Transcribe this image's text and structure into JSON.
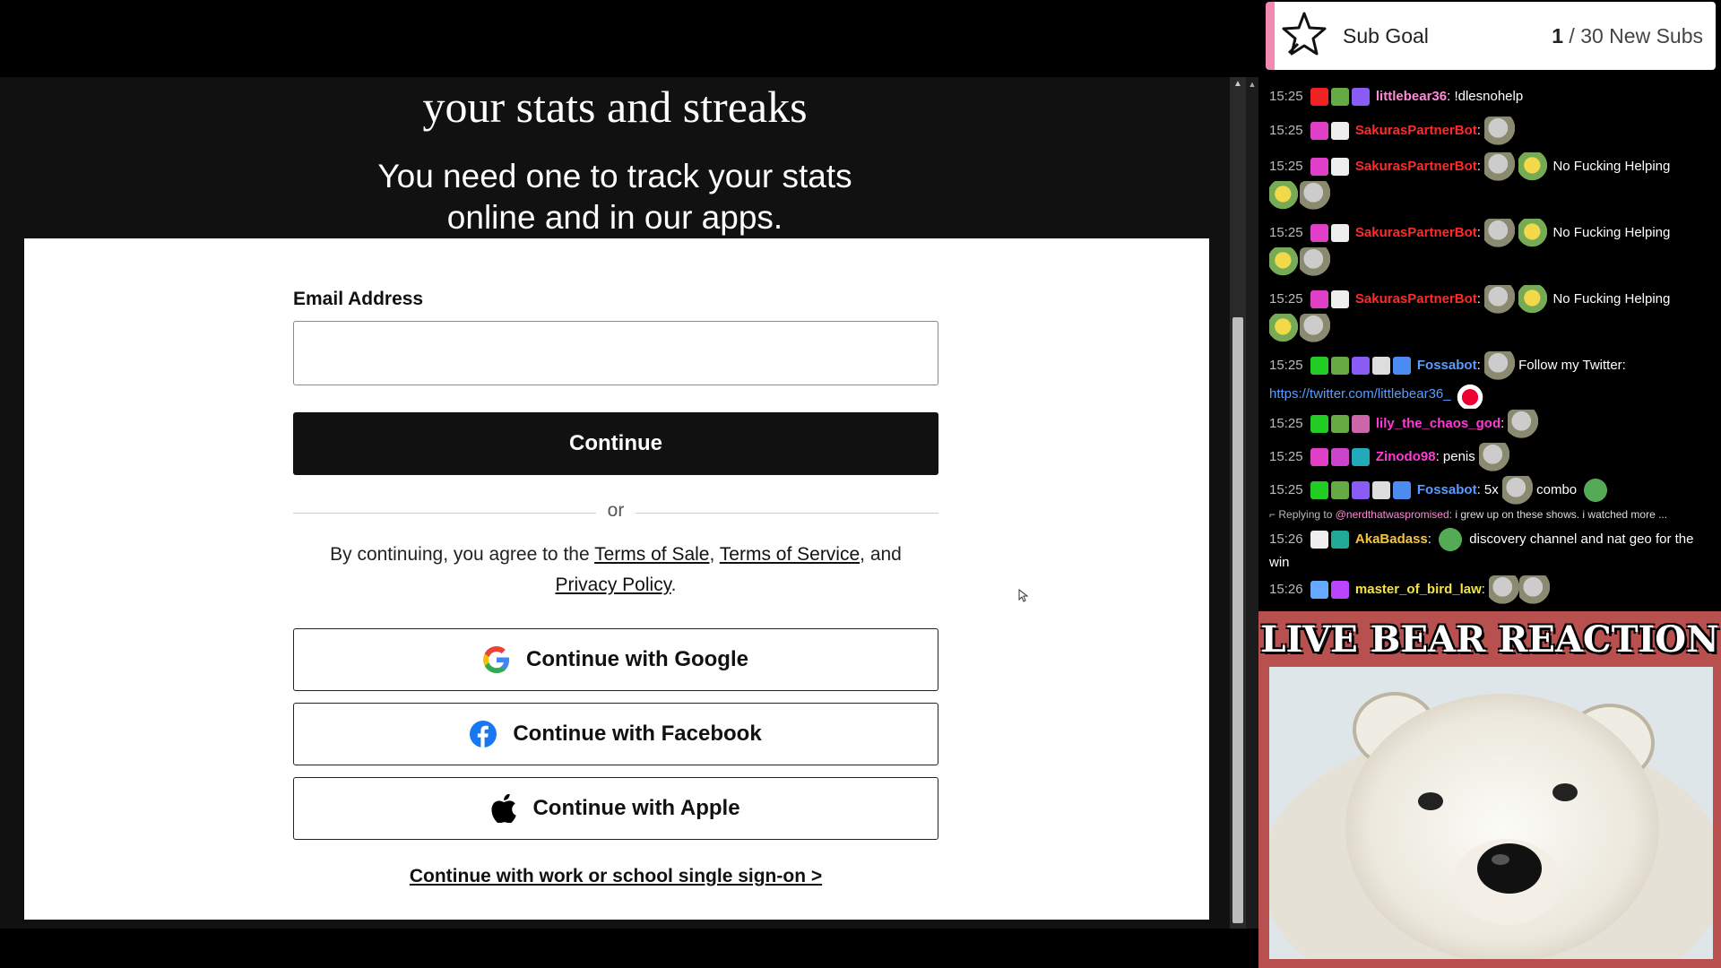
{
  "login_page": {
    "heading": "your stats and streaks",
    "subheading_line1": "You need one to track your stats",
    "subheading_line2": "online and in our apps.",
    "email_label": "Email Address",
    "email_value": "",
    "email_placeholder": "",
    "continue_label": "Continue",
    "divider_text": "or",
    "legal_prefix": "By continuing, you agree to the ",
    "terms_of_sale": "Terms of Sale",
    "comma": ", ",
    "terms_of_service": "Terms of Service",
    "and_text": ", and",
    "privacy_policy": "Privacy Policy",
    "period": ".",
    "google_label": "Continue with Google",
    "facebook_label": "Continue with Facebook",
    "apple_label": "Continue with Apple",
    "sso_label": "Continue with work or school single sign-on >"
  },
  "sub_goal": {
    "title": "Sub Goal",
    "current": "1",
    "target_text": " / 30 New Subs"
  },
  "chat": {
    "messages": [
      {
        "time": "15:25",
        "user": "littlebear36",
        "user_color": "#ff8ad8",
        "text": " !dlesnohelp"
      },
      {
        "time": "15:25",
        "user": "SakurasPartnerBot",
        "user_color": "#ff2a2a",
        "text": ""
      },
      {
        "time": "15:25",
        "user": "SakurasPartnerBot",
        "user_color": "#ff2a2a",
        "text": "No Fucking Helping"
      },
      {
        "time": "15:25",
        "user": "SakurasPartnerBot",
        "user_color": "#ff2a2a",
        "text": "No Fucking Helping"
      },
      {
        "time": "15:25",
        "user": "SakurasPartnerBot",
        "user_color": "#ff2a2a",
        "text": "No Fucking Helping"
      },
      {
        "time": "15:25",
        "user": "Fossabot",
        "user_color": "#5a9cff",
        "text": "Follow my Twitter:",
        "link": "https://twitter.com/littlebear36_"
      },
      {
        "time": "15:25",
        "user": "lily_the_chaos_god",
        "user_color": "#ff3ad6",
        "text": ""
      },
      {
        "time": "15:25",
        "user": "Zinodo98",
        "user_color": "#ff3ad6",
        "text": "penis"
      },
      {
        "time": "15:25",
        "user": "Fossabot",
        "user_color": "#5a9cff",
        "text": "5x",
        "text2": "combo"
      },
      {
        "time": "15:26",
        "user": "AkaBadass",
        "user_color": "#f5c542",
        "text": "discovery channel and nat geo for the",
        "text_wrap": "win"
      },
      {
        "time": "15:26",
        "user": "master_of_bird_law",
        "user_color": "#f5e342",
        "text": ""
      }
    ],
    "reply": {
      "prefix": "Replying to ",
      "target": "@nerdthatwaspromised:",
      "text": " i grew up on these shows. i watched more ..."
    }
  },
  "video": {
    "title": "LIVE BEAR REACTION"
  },
  "colors": {
    "subgoal_accent": "#f08ab0",
    "video_border": "#b85050",
    "chat_link": "#5a9cff"
  }
}
